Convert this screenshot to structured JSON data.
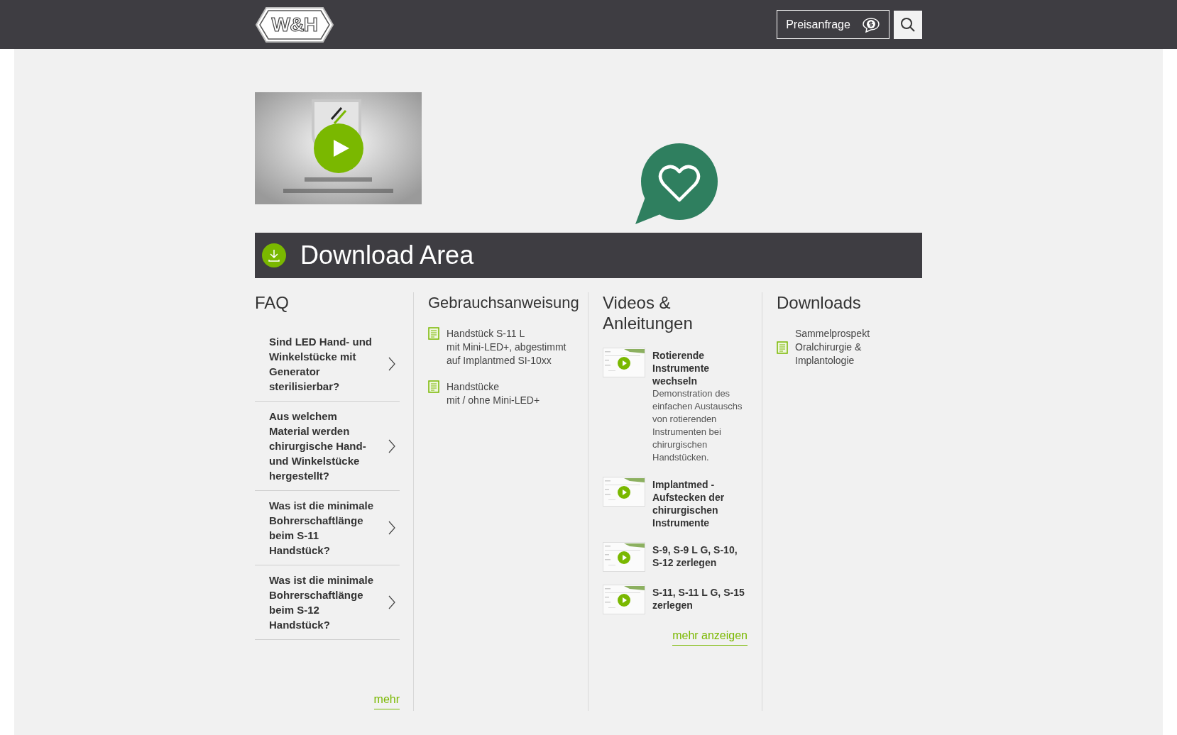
{
  "header": {
    "logo": "W&H",
    "quote_button": "Preisanfrage"
  },
  "download_area": {
    "title": "Download Area"
  },
  "faq": {
    "title": "FAQ",
    "items": [
      {
        "question": "Sind LED Hand- und Winkelstücke mit Generator sterilisierbar?"
      },
      {
        "question": "Aus welchem Material werden chirurgische Hand- und Winkelstücke hergestellt?"
      },
      {
        "question": "Was ist die minimale Bohrerschaftlänge beim S-11 Handstück?"
      },
      {
        "question": "Was ist die minimale Bohrerschaftlänge beim S-12 Handstück?"
      }
    ],
    "more_link": "mehr"
  },
  "instructions": {
    "title": "Gebrauchsanweisung",
    "items": [
      {
        "lines": [
          "Handstück S-11 L",
          "mit Mini-LED+, abgestimmt",
          "auf Implantmed SI-10xx"
        ]
      },
      {
        "lines": [
          "Handstücke",
          "mit / ohne Mini-LED+"
        ]
      }
    ]
  },
  "videos": {
    "title": "Videos & Anleitungen",
    "items": [
      {
        "title": "Rotierende Instrumente wechseln",
        "description": "Demonstration des einfachen Austauschs von rotierenden Instrumenten bei chirurgischen Handstücken."
      },
      {
        "title": "Implantmed - Aufstecken der chirurgischen Instrumente"
      },
      {
        "title": "S-9, S-9 L G, S-10, S-12 zerlegen"
      },
      {
        "title": "S-11, S-11 L G, S-15 zerlegen"
      }
    ],
    "more_link": "mehr anzeigen"
  },
  "downloads": {
    "title": "Downloads",
    "items": [
      {
        "lines": [
          "Sammelprospekt",
          "Oralchirurgie &",
          "Implantologie"
        ]
      }
    ]
  }
}
